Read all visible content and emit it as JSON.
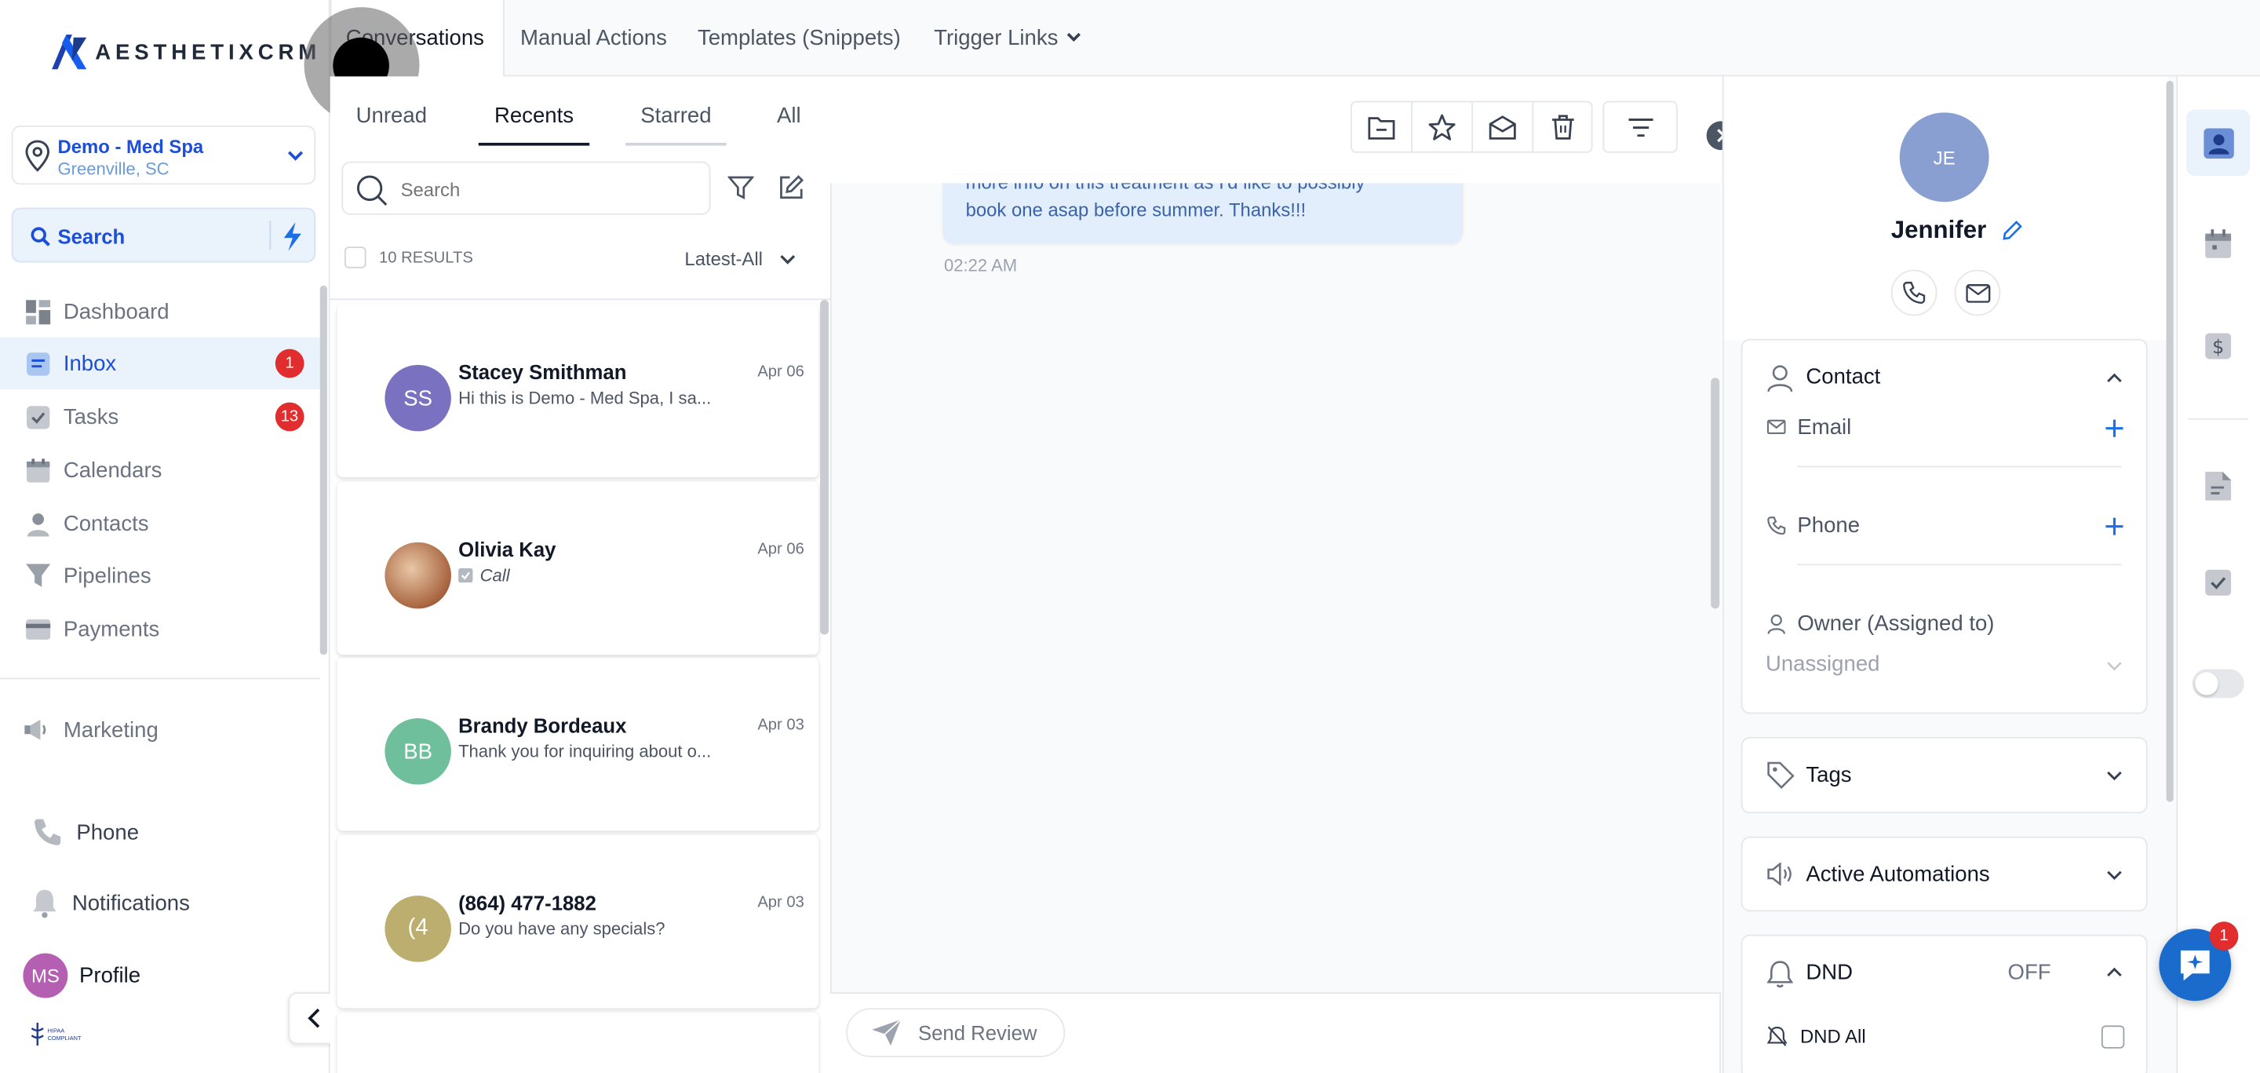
{
  "brand": {
    "name": "AESTHETIXCRM"
  },
  "location": {
    "name": "Demo - Med Spa",
    "city": "Greenville, SC"
  },
  "sidebar": {
    "search_label": "Search",
    "items": [
      {
        "label": "Dashboard"
      },
      {
        "label": "Inbox",
        "badge": "1"
      },
      {
        "label": "Tasks",
        "badge": "13"
      },
      {
        "label": "Calendars"
      },
      {
        "label": "Contacts"
      },
      {
        "label": "Pipelines"
      },
      {
        "label": "Payments"
      },
      {
        "label": "Marketing"
      }
    ],
    "bottom": {
      "phone": "Phone",
      "notifications": "Notifications",
      "profile": "Profile",
      "profile_initials": "MS",
      "compliance_text": "HIPAA COMPLIANT"
    }
  },
  "top_tabs": [
    "Conversations",
    "Manual Actions",
    "Templates (Snippets)",
    "Trigger Links"
  ],
  "list": {
    "filters": [
      "Unread",
      "Recents",
      "Starred",
      "All"
    ],
    "search_placeholder": "Search",
    "results": "10 RESULTS",
    "sort": "Latest-All",
    "conversations": [
      {
        "name": "Stacey Smithman",
        "initials": "SS",
        "date": "Apr 06",
        "preview": "Hi this is Demo - Med Spa, I sa...",
        "color": "#7a72c0"
      },
      {
        "name": "Olivia Kay",
        "initials": "",
        "date": "Apr 06",
        "preview": "Call",
        "color": "#c9a27e"
      },
      {
        "name": "Brandy Bordeaux",
        "initials": "BB",
        "date": "Apr 03",
        "preview": "Thank you for inquiring about o...",
        "color": "#6fbf9d"
      },
      {
        "name": "(864) 477-1882",
        "initials": "(4",
        "date": "Apr 03",
        "preview": "Do you have any specials?",
        "color": "#bcae6e"
      }
    ]
  },
  "thread": {
    "message_line1": "more info on this treatment as I'd like to possibly",
    "message_line2": "book one asap before summer. Thanks!!!",
    "time": "02:22 AM",
    "send_review": "Send Review"
  },
  "contact": {
    "initials": "JE",
    "name": "Jennifer",
    "section_title": "Contact",
    "email_label": "Email",
    "phone_label": "Phone",
    "owner_label": "Owner (Assigned to)",
    "owner_value": "Unassigned",
    "tags": "Tags",
    "automations": "Active Automations",
    "dnd": "DND",
    "dnd_state": "OFF",
    "dnd_all": "DND All"
  },
  "chat_widget": {
    "badge": "1"
  },
  "colors": {
    "accent": "#155eef",
    "badge": "#e12d2d",
    "avatar": "#8a9fd1"
  }
}
